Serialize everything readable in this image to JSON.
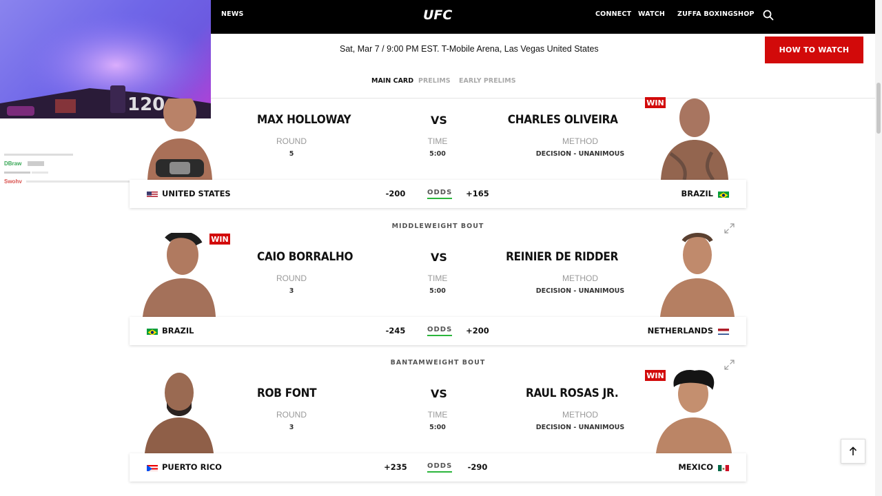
{
  "nav": {
    "left_link": "NEWS",
    "logo": "UFC",
    "right_links": [
      "CONNECT",
      "WATCH",
      "ZUFFA BOXING",
      "SHOP"
    ]
  },
  "event": {
    "info": "Sat, Mar 7 / 9:00 PM EST. T-Mobile Arena, Las Vegas United States",
    "how_to_watch": "HOW TO WATCH",
    "tabs": [
      "MAIN CARD",
      "PRELIMS",
      "EARLY PRELIMS"
    ],
    "active_tab": "MAIN CARD"
  },
  "fights": [
    {
      "weight_class": "",
      "red": {
        "name": "MAX HOLLOWAY",
        "country": "UNITED STATES",
        "odds": "-200",
        "win": false
      },
      "blue": {
        "name": "CHARLES OLIVEIRA",
        "country": "BRAZIL",
        "odds": "+165",
        "win": true
      },
      "round_label": "ROUND",
      "round": "5",
      "time_label": "TIME",
      "time": "5:00",
      "method_label": "METHOD",
      "method": "DECISION - UNANIMOUS",
      "vs": "VS",
      "odds_label": "ODDS",
      "win_label": "WIN"
    },
    {
      "weight_class": "MIDDLEWEIGHT BOUT",
      "red": {
        "name": "CAIO BORRALHO",
        "country": "BRAZIL",
        "odds": "-245",
        "win": true
      },
      "blue": {
        "name": "REINIER DE RIDDER",
        "country": "NETHERLANDS",
        "odds": "+200",
        "win": false
      },
      "round_label": "ROUND",
      "round": "3",
      "time_label": "TIME",
      "time": "5:00",
      "method_label": "METHOD",
      "method": "DECISION - UNANIMOUS",
      "vs": "VS",
      "odds_label": "ODDS",
      "win_label": "WIN"
    },
    {
      "weight_class": "BANTAMWEIGHT BOUT",
      "red": {
        "name": "ROB FONT",
        "country": "PUERTO RICO",
        "odds": "+235",
        "win": false
      },
      "blue": {
        "name": "RAUL ROSAS JR.",
        "country": "MEXICO",
        "odds": "-290",
        "win": true
      },
      "round_label": "ROUND",
      "round": "3",
      "time_label": "TIME",
      "time": "5:00",
      "method_label": "METHOD",
      "method": "DECISION - UNANIMOUS",
      "vs": "VS",
      "odds_label": "ODDS",
      "win_label": "WIN"
    }
  ],
  "stream_overlay": {
    "chat": [
      {
        "user": "DBraw",
        "color": "#3aa757"
      },
      {
        "user": "Swohv",
        "color": "#d9534f"
      }
    ]
  },
  "colors": {
    "accent": "#d20a0a",
    "odds_underline": "#2ab53b"
  }
}
